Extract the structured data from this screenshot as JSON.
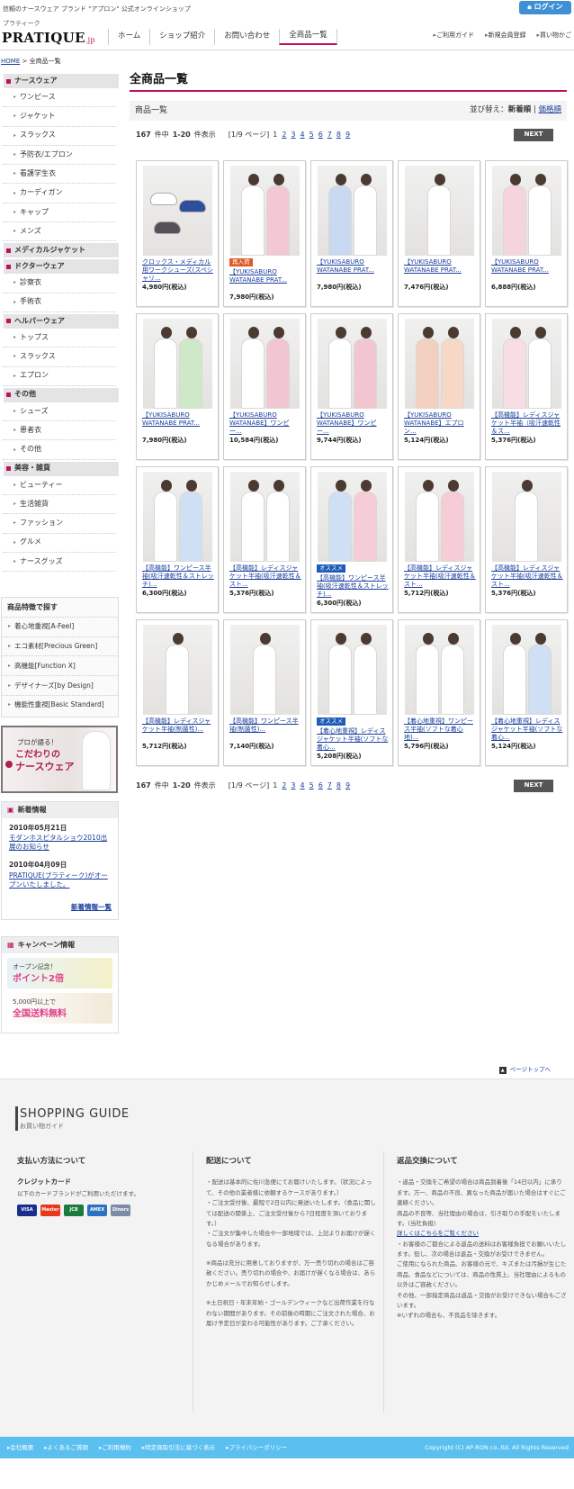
{
  "header": {
    "tagline": "信頼のナースウェア ブランド \"アプロン\" 公式オンラインショップ",
    "login": "ログイン",
    "logo_kana": "プラティーク",
    "logo": "PRATIQUE",
    "logo_suffix": ".jp",
    "gnav": [
      "ホーム",
      "ショップ紹介",
      "お問い合わせ",
      "全商品一覧"
    ],
    "subnav": [
      "ご利用ガイド",
      "新規会員登録",
      "買い物かご"
    ]
  },
  "breadcrumb": {
    "home": "HOME",
    "current": "全商品一覧"
  },
  "sidebar": {
    "groups": [
      {
        "title": "ナースウェア",
        "items": [
          "ワンピース",
          "ジャケット",
          "スラックス",
          "予防衣/エプロン",
          "看護学生衣",
          "カーディガン",
          "キャップ",
          "メンズ"
        ]
      },
      {
        "title": "メディカルジャケット",
        "items": []
      },
      {
        "title": "ドクターウェア",
        "items": [
          "診察衣",
          "手術衣"
        ]
      },
      {
        "title": "ヘルパーウェア",
        "items": [
          "トップス",
          "スラックス",
          "エプロン"
        ]
      },
      {
        "title": "その他",
        "items": [
          "シューズ",
          "患者衣",
          "その他"
        ]
      },
      {
        "title": "美容・雑貨",
        "items": [
          "ビューティー",
          "生活雑貨",
          "ファッション",
          "グルメ",
          "ナースグッズ"
        ]
      }
    ],
    "features": {
      "title": "商品特徴で探す",
      "items": [
        "着心地重視[A-Feel]",
        "エコ素材[Precious Green]",
        "高機能[Function X]",
        "デザイナーズ[by Design]",
        "機能性重視[Basic Standard]"
      ]
    },
    "banner": {
      "line1": "プロが語る！",
      "line2": "こだわりの",
      "line3": "ナースウェア"
    },
    "news": {
      "title": "新着情報",
      "entries": [
        {
          "date": "2010年05月21日",
          "text": "モダンホスピタルショウ2010出展のお知らせ"
        },
        {
          "date": "2010年04月09日",
          "text": "PRATIQUE(プラティーク)がオープンいたしました。"
        }
      ],
      "more": "新着情報一覧"
    },
    "campaign": {
      "title": "キャンペーン情報",
      "b1_l1": "オープン記念！",
      "b1_l2": "ポイント2倍",
      "b2_l1": "5,000円以上で",
      "b2_l2": "全国送料無料"
    }
  },
  "main": {
    "title": "全商品一覧",
    "list_title": "商品一覧",
    "sort_label": "並び替え：",
    "sort_current": "新着順",
    "sort_other": "価格順",
    "pager": {
      "total": "167",
      "total_unit": "件中",
      "range": "1-20",
      "range_unit": "件表示",
      "page_info": "[1/9 ページ]",
      "current_page": "1",
      "pages": [
        "2",
        "3",
        "4",
        "5",
        "6",
        "7",
        "8",
        "9"
      ],
      "next": "NEXT"
    },
    "products": [
      {
        "name": "クロックス・メディカル用ワークシューズ(スペシャリ...",
        "price": "4,980円(税込)",
        "badge": "",
        "type": "shoes",
        "c1": "#ffffff",
        "c2": "#ffffff"
      },
      {
        "name": "【YUKISABURO WATANABE PRAT...",
        "price": "7,980円(税込)",
        "badge": "再入荷",
        "type": "two",
        "c1": "#ffffff",
        "c2": "#f4c8d2"
      },
      {
        "name": "【YUKISABURO WATANABE PRAT...",
        "price": "7,980円(税込)",
        "badge": "",
        "type": "two",
        "c1": "#c9d9f2",
        "c2": "#ffffff"
      },
      {
        "name": "【YUKISABURO WATANABE PRAT...",
        "price": "7,476円(税込)",
        "badge": "",
        "type": "one",
        "c1": "#ffffff",
        "c2": "#ffffff"
      },
      {
        "name": "【YUKISABURO WATANABE PRAT...",
        "price": "6,888円(税込)",
        "badge": "",
        "type": "two",
        "c1": "#f6d4dc",
        "c2": "#ffffff"
      },
      {
        "name": "【YUKISABURO WATANABE PRAT...",
        "price": "7,980円(税込)",
        "badge": "",
        "type": "two",
        "c1": "#ffffff",
        "c2": "#cfe8c8"
      },
      {
        "name": "【YUKISABURO WATANABE】ワンピー...",
        "price": "10,584円(税込)",
        "badge": "",
        "type": "two",
        "c1": "#ffffff",
        "c2": "#f2c6d0"
      },
      {
        "name": "【YUKISABURO WATANABE】ワンピー...",
        "price": "9,744円(税込)",
        "badge": "",
        "type": "two",
        "c1": "#ffffff",
        "c2": "#f2c6d0"
      },
      {
        "name": "【YUKISABURO WATANABE】エプロン...",
        "price": "5,124円(税込)",
        "badge": "",
        "type": "two",
        "c1": "#f3cfc0",
        "c2": "#f7d7c6"
      },
      {
        "name": "【高機能】レディスジャケット半袖（吸汗速乾性＆ス...",
        "price": "5,376円(税込)",
        "badge": "",
        "type": "two",
        "c1": "#f8dde4",
        "c2": "#ffffff"
      },
      {
        "name": "【高機能】ワンピース半袖(吸汗速乾性＆ストレッチ)...",
        "price": "6,300円(税込)",
        "badge": "",
        "type": "two",
        "c1": "#ffffff",
        "c2": "#cfe0f4"
      },
      {
        "name": "【高機能】レディスジャケット半袖(吸汗速乾性＆スト...",
        "price": "5,376円(税込)",
        "badge": "",
        "type": "two",
        "c1": "#ffffff",
        "c2": "#ffffff"
      },
      {
        "name": "【高機能】ワンピース半袖(吸汗速乾性＆ストレッチ)...",
        "price": "6,300円(税込)",
        "badge": "オススメ",
        "type": "two",
        "c1": "#cfe0f4",
        "c2": "#f6cdd6"
      },
      {
        "name": "【高機能】レディスジャケット半袖(吸汗速乾性＆スト...",
        "price": "5,712円(税込)",
        "badge": "",
        "type": "two",
        "c1": "#ffffff",
        "c2": "#f6cdd6"
      },
      {
        "name": "【高機能】レディスジャケット半袖(吸汗速乾性＆スト...",
        "price": "5,376円(税込)",
        "badge": "",
        "type": "one",
        "c1": "#ffffff",
        "c2": "#ffffff"
      },
      {
        "name": "【高機能】レディスジャケット半袖(制菌性)...",
        "price": "5,712円(税込)",
        "badge": "",
        "type": "one",
        "c1": "#ffffff",
        "c2": "#ffffff"
      },
      {
        "name": "【高機能】ワンピース半袖(制菌性)...",
        "price": "7,140円(税込)",
        "badge": "",
        "type": "one",
        "c1": "#ffffff",
        "c2": "#ffffff"
      },
      {
        "name": "【着心地重視】レディスジャケット半袖(ソフトな着心...",
        "price": "5,208円(税込)",
        "badge": "オススメ",
        "type": "two",
        "c1": "#ffffff",
        "c2": "#ffffff"
      },
      {
        "name": "【着心地重視】ワンピース半袖(ソフトな着心地)...",
        "price": "5,796円(税込)",
        "badge": "",
        "type": "two",
        "c1": "#ffffff",
        "c2": "#ffffff"
      },
      {
        "name": "【着心地重視】レディスジャケット半袖(ソフトな着心...",
        "price": "5,124円(税込)",
        "badge": "",
        "type": "two",
        "c1": "#ffffff",
        "c2": "#cfe0f4"
      }
    ]
  },
  "pagetop": "ページトップへ",
  "guide": {
    "title": "SHOPPING GUIDE",
    "subtitle": "お買い物ガイド",
    "pay": {
      "title": "支払い方法について",
      "sub": "クレジットカード",
      "text": "以下のカードブランドがご利用いただけます。",
      "cards": [
        "VISA",
        "Master",
        "JCB",
        "AMEX",
        "Diners"
      ]
    },
    "ship": {
      "title": "配送について",
      "p1": "・配送は基本的に佐川急便にてお届けいたします。（状況によって、その他の業者様に依頼するケースがあります。）",
      "p2": "・ご注文受付後、最短で2日以内に発送いたします。（食品に関しては配送の関係上、ご注文受付後から7日程度を頂いております。）",
      "p3": "・ご注文が集中した場合や一部地域では、上記よりお届けが遅くなる場合があります。",
      "p4": "※商品は充分に用意しておりますが、万一売り切れの場合はご容赦ください。売り切れの場合や、お届けが遅くなる場合は、あらかじめメールでお知らせします。",
      "p5": "※土日祝日・年末年始・ゴールデンウィークなど出荷作業を行なわない期間があります。その前後の時期にご注文された場合、お届け予定日が変わる可能性があります。ご了承ください。"
    },
    "ret": {
      "title": "返品交換について",
      "p1": "・返品・交換をご希望の場合は商品到着後「14日以内」に承ります。万一、商品の不良、異なった商品が届いた場合はすぐにご連絡ください。",
      "p2": "商品の不良等、当社理由の場合は、引き取りの手配をいたします。(当社負担)",
      "p3": "詳しくはこちらをご覧ください",
      "p4": "・お客様のご都合による返品の送料はお客様負担でお願いいたします。但し、次の場合は返品・交換がお受けできません。",
      "p5": "ご使用になられた商品、お客様の元で、キズまたは汚損が生じた商品、食品などについては、商品の性質上、当社理由によるもの以外はご容赦ください。",
      "p6": "その他、一部指定商品は返品・交換がお受けできない場合もございます。",
      "p7": "※いずれの場合も、不良品を除きます。"
    }
  },
  "footer": {
    "links": [
      "会社概要",
      "よくあるご質問",
      "ご利用規約",
      "特定商取引法に基づく表示",
      "プライバシーポリシー"
    ],
    "copyright": "Copyright (C) AP-RON co.,ltd. All Rights Reserved"
  },
  "colors": {
    "accent": "#c01060",
    "link": "#1a3f9c",
    "footer": "#5bc0f0",
    "login": "#3f8fd4"
  }
}
